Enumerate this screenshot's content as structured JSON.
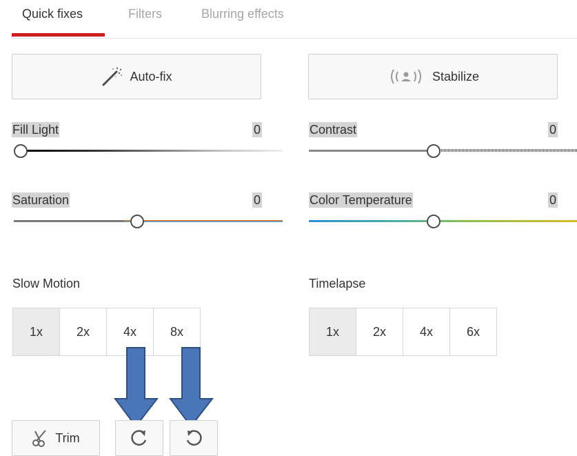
{
  "tabs": [
    {
      "label": "Quick fixes",
      "active": true
    },
    {
      "label": "Filters",
      "active": false
    },
    {
      "label": "Blurring effects",
      "active": false
    }
  ],
  "buttons": {
    "auto_fix": {
      "label": "Auto-fix",
      "icon": "magic-wand-icon"
    },
    "stabilize": {
      "label": "Stabilize",
      "icon": "stabilize-icon"
    }
  },
  "sliders": [
    {
      "label": "Fill Light",
      "value": "0",
      "level": 0.0
    },
    {
      "label": "Contrast",
      "value": "0",
      "level": 0.5
    },
    {
      "label": "Saturation",
      "value": "0",
      "level": 0.5
    },
    {
      "label": "Color Temperature",
      "value": "0",
      "level": 0.5
    }
  ],
  "slow_motion": {
    "label": "Slow Motion",
    "options": [
      "1x",
      "2x",
      "4x",
      "8x"
    ],
    "selected": "1x"
  },
  "timelapse": {
    "label": "Timelapse",
    "options": [
      "1x",
      "2x",
      "4x",
      "6x"
    ],
    "selected": "1x"
  },
  "toolbar": {
    "trim_label": "Trim",
    "trim_icon": "scissors-icon",
    "rotate_right_icon": "rotate-clockwise-icon",
    "rotate_left_icon": "rotate-counterclockwise-icon"
  },
  "annotations": {
    "arrow_color": "#4a76b8",
    "count": 2
  },
  "colors": {
    "accent": "#cc1f1f",
    "selected_segment": "#ebebeb"
  }
}
